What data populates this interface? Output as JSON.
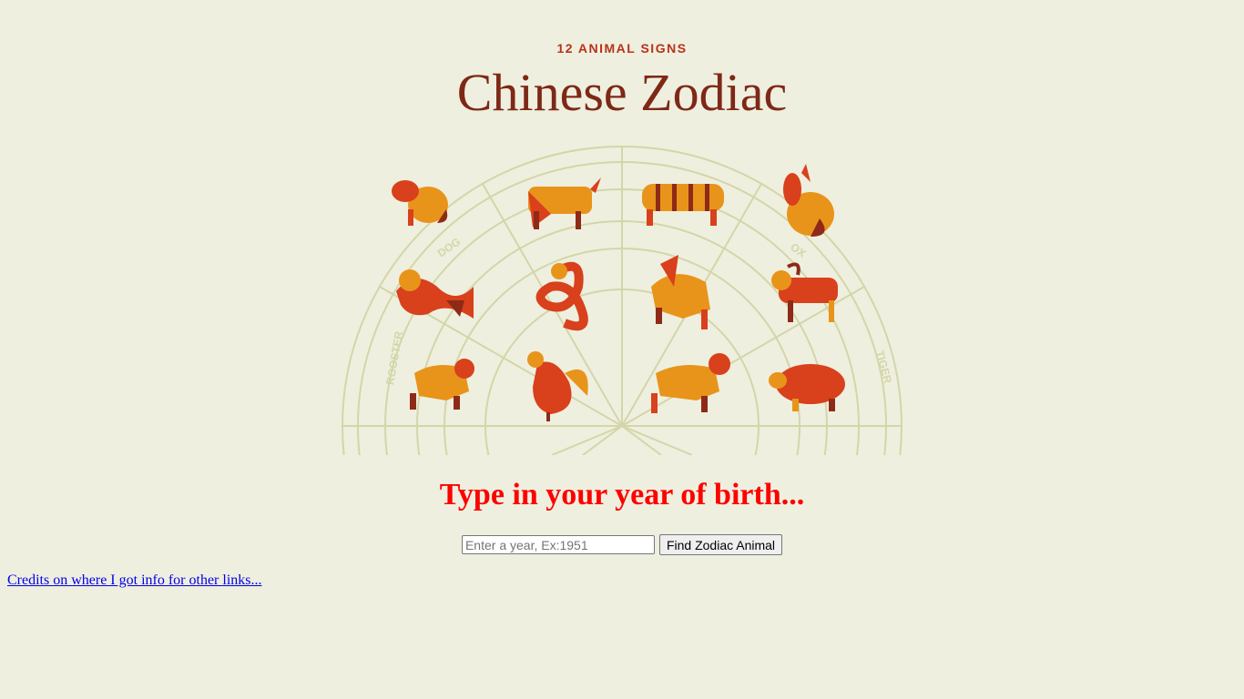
{
  "banner": {
    "subtitle": "12 ANIMAL SIGNS",
    "title": "Chinese Zodiac",
    "wheel_labels": [
      "DOG",
      "OX",
      "ROOSTER",
      "TIGER"
    ],
    "animals": [
      "rat",
      "ox",
      "tiger",
      "rabbit",
      "dragon",
      "snake",
      "horse",
      "goat",
      "monkey",
      "rooster",
      "dog",
      "pig"
    ]
  },
  "main": {
    "prompt": "Type in your year of birth...",
    "year_input": {
      "value": "",
      "placeholder": "Enter a year, Ex:1951"
    },
    "find_button_label": "Find Zodiac Animal",
    "credits_link": "Credits on where I got info for other links..."
  },
  "colors": {
    "background": "#efefdf",
    "title": "#7e2817",
    "subtitle": "#b8321a",
    "prompt": "#ff0000",
    "link": "#0000ee",
    "wheel_lines": "#d3d6a8",
    "animal_orange": "#e8941a",
    "animal_red": "#d9401c",
    "animal_dark": "#8e2a17"
  }
}
